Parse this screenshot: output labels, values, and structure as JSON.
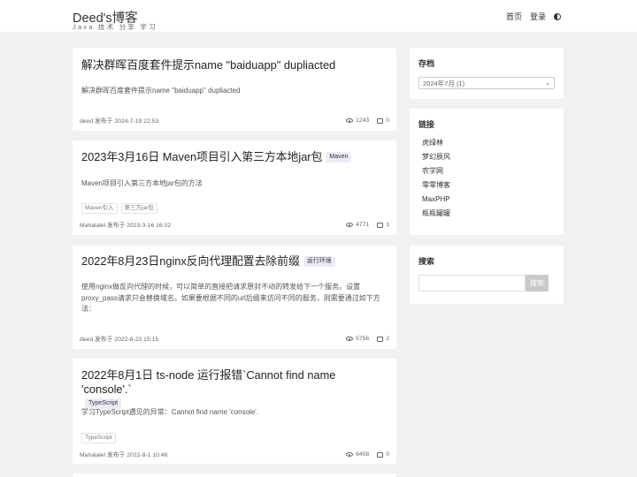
{
  "header": {
    "brand": "Deed's博客",
    "tagline": "Java 技术 分享 学习",
    "nav": {
      "home": "首页",
      "login": "登录"
    }
  },
  "posts": [
    {
      "title": "解决群晖百度套件提示name \"baiduapp\" dupliacted",
      "badge": "",
      "summary": "解决群晖百度套件提示name \"baiduapp\" dupliacted",
      "tags": [],
      "meta": "deed 发布于  2024-7-19 22:53",
      "views": "1243",
      "comments": "0"
    },
    {
      "title": "2023年3月16日 Maven项目引入第三方本地jar包",
      "badge": "Maven",
      "summary": "Maven项目引入第三方本地jar包的方法",
      "tags": [
        "Maven引入",
        "第三方jar包"
      ],
      "meta": "Mahalalel 发布于  2023-3-16 16:02",
      "views": "4771",
      "comments": "1"
    },
    {
      "title": "2022年8月23日nginx反向代理配置去除前缀",
      "badge": "运行环境",
      "summary": "使用nginx做反向代理的时候，可以简单的直接把请求原封不动的转发给下一个服务。设置proxy_pass请求只会替换域名。如果要根据不同的url后缀来访问不同的服务，则需要通过如下方法：",
      "tags": [],
      "meta": "deed 发布于  2022-8-23 15:15",
      "views": "5756",
      "comments": "2"
    },
    {
      "title": "2022年8月1日 ts-node 运行报错`Cannot find name 'console'.`",
      "badge": "TypeScript",
      "summary": "学习TypeScript遇见的异常：Cannot find name 'console'.",
      "tags": [
        "TypeScript"
      ],
      "meta": "Mahalalel 发布于  2022-8-1 10:46",
      "views": "6408",
      "comments": "0"
    }
  ],
  "sidebar": {
    "archive": {
      "title": "存档",
      "selected": "2024年7月  (1)"
    },
    "links": {
      "title": "链接",
      "items": [
        "虎绿林",
        "梦幻辰风",
        "农学网",
        "零零博客",
        "MaxPHP",
        "瓶瓶罐罐"
      ]
    },
    "search": {
      "title": "搜索",
      "button": "搜索",
      "placeholder": ""
    }
  }
}
